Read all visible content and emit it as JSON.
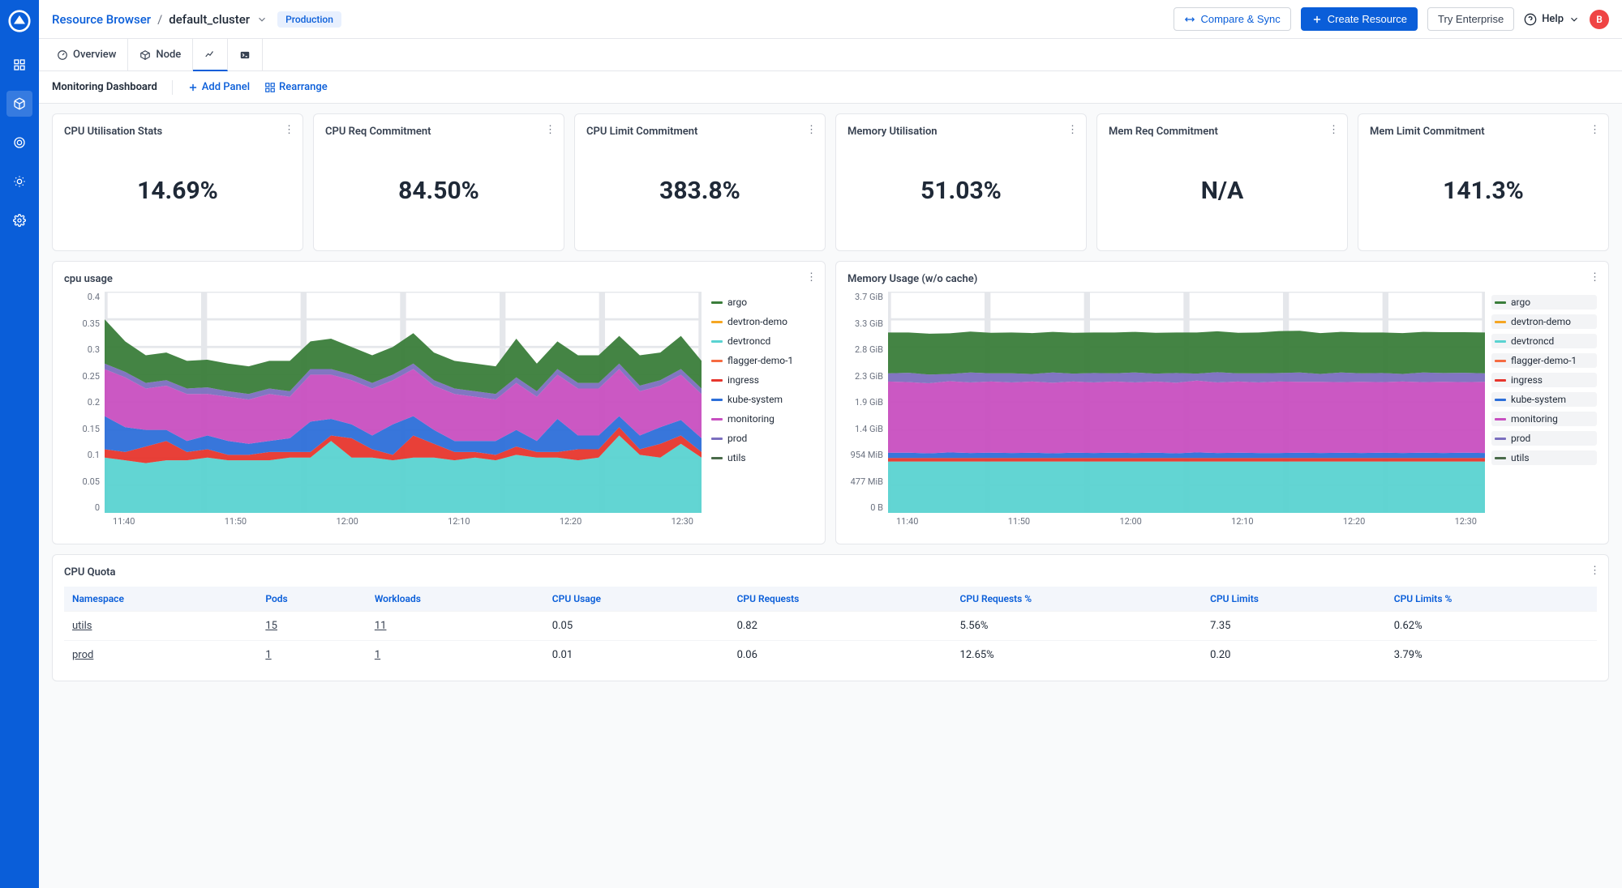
{
  "breadcrumb": {
    "root": "Resource Browser",
    "cluster": "default_cluster"
  },
  "env_badge": "Production",
  "topbar": {
    "compare": "Compare & Sync",
    "create": "Create Resource",
    "enterprise": "Try Enterprise",
    "help": "Help",
    "avatar": "B"
  },
  "tabs": {
    "overview": "Overview",
    "node": "Node"
  },
  "subbar": {
    "title": "Monitoring Dashboard",
    "add_panel": "Add Panel",
    "rearrange": "Rearrange"
  },
  "stats": [
    {
      "title": "CPU Utilisation Stats",
      "value": "14.69%"
    },
    {
      "title": "CPU Req Commitment",
      "value": "84.50%"
    },
    {
      "title": "CPU Limit Commitment",
      "value": "383.8%"
    },
    {
      "title": "Memory Utilisation",
      "value": "51.03%"
    },
    {
      "title": "Mem Req Commitment",
      "value": "N/A"
    },
    {
      "title": "Mem Limit Commitment",
      "value": "141.3%"
    }
  ],
  "legend": {
    "series": [
      {
        "name": "argo",
        "color": "#3a7d3a"
      },
      {
        "name": "devtron-demo",
        "color": "#f5a623"
      },
      {
        "name": "devtroncd",
        "color": "#5ad3d1"
      },
      {
        "name": "flagger-demo-1",
        "color": "#f56b42"
      },
      {
        "name": "ingress",
        "color": "#e7362d"
      },
      {
        "name": "kube-system",
        "color": "#2d6fd9"
      },
      {
        "name": "monitoring",
        "color": "#c84fc0"
      },
      {
        "name": "prod",
        "color": "#7b6fbf"
      },
      {
        "name": "utils",
        "color": "#4a6b4a"
      }
    ]
  },
  "cpu_chart": {
    "title": "cpu usage"
  },
  "mem_chart": {
    "title": "Memory Usage (w/o cache)"
  },
  "quota": {
    "title": "CPU Quota",
    "columns": [
      "Namespace",
      "Pods",
      "Workloads",
      "CPU Usage",
      "CPU Requests",
      "CPU Requests %",
      "CPU Limits",
      "CPU Limits %"
    ],
    "rows": [
      {
        "ns": "utils",
        "pods": "15",
        "workloads": "11",
        "usage": "0.05",
        "req": "0.82",
        "req_pct": "5.56%",
        "lim": "7.35",
        "lim_pct": "0.62%"
      },
      {
        "ns": "prod",
        "pods": "1",
        "workloads": "1",
        "usage": "0.01",
        "req": "0.06",
        "req_pct": "12.65%",
        "lim": "0.20",
        "lim_pct": "3.79%"
      }
    ]
  },
  "chart_data": [
    {
      "type": "area",
      "title": "cpu usage",
      "xlabel": "",
      "ylabel": "",
      "ylim": [
        0,
        0.4
      ],
      "x_ticks": [
        "11:40",
        "11:50",
        "12:00",
        "12:10",
        "12:20",
        "12:30"
      ],
      "y_ticks": [
        0,
        0.05,
        0.1,
        0.15,
        0.2,
        0.25,
        0.3,
        0.35,
        0.4
      ],
      "stacked": true,
      "x": [
        "11:40",
        "11:42",
        "11:44",
        "11:46",
        "11:48",
        "11:50",
        "11:52",
        "11:54",
        "11:56",
        "11:58",
        "12:00",
        "12:02",
        "12:04",
        "12:06",
        "12:08",
        "12:10",
        "12:12",
        "12:14",
        "12:16",
        "12:18",
        "12:20",
        "12:22",
        "12:24",
        "12:26",
        "12:28",
        "12:30",
        "12:32",
        "12:34",
        "12:36",
        "12:38"
      ],
      "series": [
        {
          "name": "devtroncd",
          "color": "#5ad3d1",
          "values": [
            0.1,
            0.095,
            0.09,
            0.095,
            0.095,
            0.1,
            0.095,
            0.095,
            0.095,
            0.1,
            0.1,
            0.13,
            0.1,
            0.1,
            0.095,
            0.1,
            0.1,
            0.095,
            0.1,
            0.095,
            0.105,
            0.1,
            0.1,
            0.095,
            0.1,
            0.14,
            0.105,
            0.1,
            0.125,
            0.1
          ]
        },
        {
          "name": "ingress",
          "color": "#e7362d",
          "values": [
            0.015,
            0.015,
            0.03,
            0.035,
            0.015,
            0.015,
            0.01,
            0.01,
            0.015,
            0.01,
            0.01,
            0.01,
            0.035,
            0.015,
            0.01,
            0.04,
            0.025,
            0.015,
            0.01,
            0.01,
            0.015,
            0.01,
            0.01,
            0.02,
            0.015,
            0.015,
            0.01,
            0.025,
            0.015,
            0.01
          ]
        },
        {
          "name": "kube-system",
          "color": "#2d6fd9",
          "values": [
            0.06,
            0.045,
            0.03,
            0.02,
            0.02,
            0.025,
            0.025,
            0.02,
            0.02,
            0.025,
            0.055,
            0.03,
            0.025,
            0.025,
            0.055,
            0.035,
            0.025,
            0.02,
            0.02,
            0.025,
            0.03,
            0.02,
            0.06,
            0.025,
            0.025,
            0.02,
            0.025,
            0.03,
            0.028,
            0.025
          ]
        },
        {
          "name": "monitoring",
          "color": "#c84fc0",
          "values": [
            0.085,
            0.09,
            0.075,
            0.08,
            0.085,
            0.075,
            0.08,
            0.08,
            0.085,
            0.075,
            0.085,
            0.08,
            0.08,
            0.085,
            0.08,
            0.085,
            0.08,
            0.085,
            0.08,
            0.075,
            0.085,
            0.08,
            0.08,
            0.085,
            0.085,
            0.085,
            0.08,
            0.075,
            0.082,
            0.08
          ]
        },
        {
          "name": "prod",
          "color": "#7b6fbf",
          "values": [
            0.01,
            0.01,
            0.01,
            0.01,
            0.01,
            0.012,
            0.01,
            0.01,
            0.01,
            0.01,
            0.01,
            0.01,
            0.01,
            0.01,
            0.01,
            0.01,
            0.01,
            0.01,
            0.01,
            0.01,
            0.01,
            0.01,
            0.01,
            0.01,
            0.01,
            0.01,
            0.01,
            0.01,
            0.01,
            0.01
          ]
        },
        {
          "name": "argo",
          "color": "#3a7d3a",
          "values": [
            0.08,
            0.055,
            0.05,
            0.05,
            0.05,
            0.05,
            0.05,
            0.05,
            0.05,
            0.055,
            0.05,
            0.055,
            0.05,
            0.05,
            0.05,
            0.055,
            0.05,
            0.05,
            0.05,
            0.05,
            0.07,
            0.05,
            0.05,
            0.05,
            0.05,
            0.05,
            0.055,
            0.05,
            0.06,
            0.05
          ]
        },
        {
          "name": "devtron-demo",
          "color": "#f5a623",
          "values": [
            0.0,
            0.0,
            0.0,
            0.0,
            0.0,
            0.0,
            0.0,
            0.0,
            0.0,
            0.0,
            0.0,
            0.0,
            0.0,
            0.0,
            0.0,
            0.0,
            0.0,
            0.0,
            0.0,
            0.0,
            0.0,
            0.0,
            0.0,
            0.0,
            0.0,
            0.0,
            0.0,
            0.0,
            0.0,
            0.0
          ]
        },
        {
          "name": "flagger-demo-1",
          "color": "#f56b42",
          "values": [
            0.0,
            0.0,
            0.0,
            0.0,
            0.0,
            0.0,
            0.0,
            0.0,
            0.0,
            0.0,
            0.0,
            0.0,
            0.0,
            0.0,
            0.0,
            0.0,
            0.0,
            0.0,
            0.0,
            0.0,
            0.0,
            0.0,
            0.0,
            0.0,
            0.0,
            0.0,
            0.0,
            0.0,
            0.0,
            0.0
          ]
        },
        {
          "name": "utils",
          "color": "#4a6b4a",
          "values": [
            0.0,
            0.0,
            0.0,
            0.0,
            0.0,
            0.0,
            0.0,
            0.0,
            0.0,
            0.0,
            0.0,
            0.0,
            0.0,
            0.0,
            0.0,
            0.0,
            0.0,
            0.0,
            0.0,
            0.0,
            0.0,
            0.0,
            0.0,
            0.0,
            0.0,
            0.0,
            0.0,
            0.0,
            0.0,
            0.0
          ]
        }
      ]
    },
    {
      "type": "area",
      "title": "Memory Usage (w/o cache)",
      "xlabel": "",
      "ylabel": "",
      "ylim_bytes": [
        0,
        3972844748
      ],
      "x_ticks": [
        "11:40",
        "11:50",
        "12:00",
        "12:10",
        "12:20",
        "12:30"
      ],
      "y_ticks": [
        "0 B",
        "477 MiB",
        "954 MiB",
        "1.4 GiB",
        "1.9 GiB",
        "2.3 GiB",
        "2.8 GiB",
        "3.3 GiB",
        "3.7 GiB"
      ],
      "stacked": true,
      "unit": "bytes",
      "x": [
        "11:40",
        "11:42",
        "11:44",
        "11:46",
        "11:48",
        "11:50",
        "11:52",
        "11:54",
        "11:56",
        "11:58",
        "12:00",
        "12:02",
        "12:04",
        "12:06",
        "12:08",
        "12:10",
        "12:12",
        "12:14",
        "12:16",
        "12:18",
        "12:20",
        "12:22",
        "12:24",
        "12:26",
        "12:28",
        "12:30",
        "12:32",
        "12:34",
        "12:36",
        "12:38"
      ],
      "series": [
        {
          "name": "devtroncd",
          "color": "#5ad3d1",
          "values_mib": [
            880,
            880,
            880,
            880,
            880,
            880,
            880,
            880,
            880,
            880,
            880,
            880,
            880,
            880,
            880,
            880,
            880,
            880,
            880,
            880,
            880,
            880,
            880,
            880,
            880,
            880,
            880,
            880,
            880,
            880
          ]
        },
        {
          "name": "ingress",
          "color": "#e7362d",
          "values_mib": [
            60,
            60,
            60,
            60,
            60,
            60,
            60,
            60,
            60,
            60,
            60,
            60,
            60,
            60,
            60,
            60,
            60,
            60,
            60,
            60,
            60,
            60,
            60,
            60,
            60,
            60,
            60,
            60,
            60,
            60
          ]
        },
        {
          "name": "kube-system",
          "color": "#2d6fd9",
          "values_mib": [
            90,
            90,
            80,
            95,
            85,
            90,
            85,
            90,
            80,
            90,
            85,
            90,
            85,
            90,
            80,
            95,
            85,
            90,
            85,
            85,
            90,
            85,
            90,
            85,
            90,
            85,
            90,
            85,
            90,
            85
          ]
        },
        {
          "name": "monitoring",
          "color": "#c84fc0",
          "values_mib": [
            1220,
            1210,
            1200,
            1220,
            1210,
            1220,
            1210,
            1220,
            1210,
            1220,
            1210,
            1220,
            1210,
            1220,
            1210,
            1230,
            1210,
            1220,
            1210,
            1225,
            1215,
            1220,
            1210,
            1220,
            1210,
            1225,
            1210,
            1220,
            1210,
            1220
          ]
        },
        {
          "name": "prod",
          "color": "#7b6fbf",
          "values_mib": [
            140,
            160,
            150,
            125,
            170,
            140,
            155,
            130,
            175,
            135,
            160,
            140,
            170,
            135,
            165,
            120,
            175,
            140,
            155,
            145,
            160,
            135,
            165,
            145,
            155,
            130,
            165,
            150,
            160,
            145
          ]
        },
        {
          "name": "argo",
          "color": "#3a7d3a",
          "values_mib": [
            700,
            690,
            700,
            695,
            700,
            695,
            700,
            700,
            695,
            700,
            695,
            700,
            695,
            700,
            695,
            705,
            700,
            695,
            700,
            720,
            715,
            700,
            695,
            700,
            695,
            700,
            695,
            700,
            695,
            700
          ]
        },
        {
          "name": "devtron-demo",
          "color": "#f5a623",
          "values_mib": [
            0,
            0,
            0,
            0,
            0,
            0,
            0,
            0,
            0,
            0,
            0,
            0,
            0,
            0,
            0,
            0,
            0,
            0,
            0,
            0,
            0,
            0,
            0,
            0,
            0,
            0,
            0,
            0,
            0,
            0
          ]
        },
        {
          "name": "flagger-demo-1",
          "color": "#f56b42",
          "values_mib": [
            0,
            0,
            0,
            0,
            0,
            0,
            0,
            0,
            0,
            0,
            0,
            0,
            0,
            0,
            0,
            0,
            0,
            0,
            0,
            0,
            0,
            0,
            0,
            0,
            0,
            0,
            0,
            0,
            0,
            0
          ]
        },
        {
          "name": "utils",
          "color": "#4a6b4a",
          "values_mib": [
            0,
            0,
            0,
            0,
            0,
            0,
            0,
            0,
            0,
            0,
            0,
            0,
            0,
            0,
            0,
            0,
            0,
            0,
            0,
            0,
            0,
            0,
            0,
            0,
            0,
            0,
            0,
            0,
            0,
            0
          ]
        }
      ]
    }
  ]
}
